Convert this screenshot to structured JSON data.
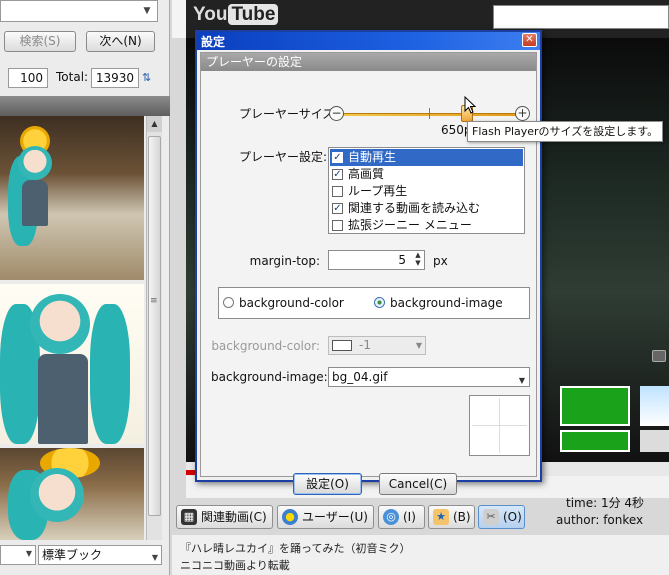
{
  "left_panel": {
    "top_select_value": "",
    "search_button": "検索(S)",
    "next_button": "次へ(N)",
    "page_value": "100",
    "total_label": "Total:",
    "total_value": "13930",
    "bottom_select_value": "",
    "book_select_value": "標準ブック"
  },
  "youtube": {
    "logo_you": "You",
    "logo_tube": "Tube",
    "search_value": ""
  },
  "video": {
    "progress_fraction": 0.66,
    "time_label": "time: 1分 4秒",
    "author_label": "author: fonkex"
  },
  "tabs": [
    {
      "label": "関連動画(C)",
      "icon": "film-icon"
    },
    {
      "label": "ユーザー(U)",
      "icon": "user-icon"
    },
    {
      "label": "(I)",
      "icon": "info-globe-icon"
    },
    {
      "label": "(B)",
      "icon": "bookmark-icon"
    },
    {
      "label": "(O)",
      "icon": "settings-tools-icon"
    }
  ],
  "status": {
    "line1": "『ハレ晴レユカイ』を踊ってみた（初音ミク）",
    "line2": "ニコニコ動画より転載"
  },
  "dialog": {
    "title": "設定",
    "close_symbol": "✕",
    "section_header": "プレーヤーの設定",
    "player_size_label": "プレーヤーサイズ:",
    "player_size_readout": "650px : 487px",
    "player_size_fraction": 0.72,
    "player_options_label": "プレーヤー設定:",
    "player_options": [
      {
        "label": "自動再生",
        "checked": true,
        "selected": true
      },
      {
        "label": "高画質",
        "checked": true,
        "selected": false
      },
      {
        "label": "ループ再生",
        "checked": false,
        "selected": false
      },
      {
        "label": "関連する動画を読み込む",
        "checked": true,
        "selected": false
      },
      {
        "label": "拡張ジーニー メニュー",
        "checked": false,
        "selected": false
      }
    ],
    "margin_top_label": "margin-top:",
    "margin_top_value": "5",
    "margin_top_unit": "px",
    "radio_bg_color": "background-color",
    "radio_bg_image": "background-image",
    "bg_color_label": "background-color:",
    "bg_color_value": "-1",
    "bg_image_label": "background-image:",
    "bg_image_value": "bg_04.gif",
    "ok_button": "設定(O)",
    "cancel_button": "Cancel(C)"
  },
  "tooltip": "Flash Playerのサイズを設定します。",
  "colors": {
    "dialog_title_bar": "#0a3fbf",
    "selection": "#3169c6",
    "progress": "#d10000",
    "slider": "#e39a1a"
  }
}
